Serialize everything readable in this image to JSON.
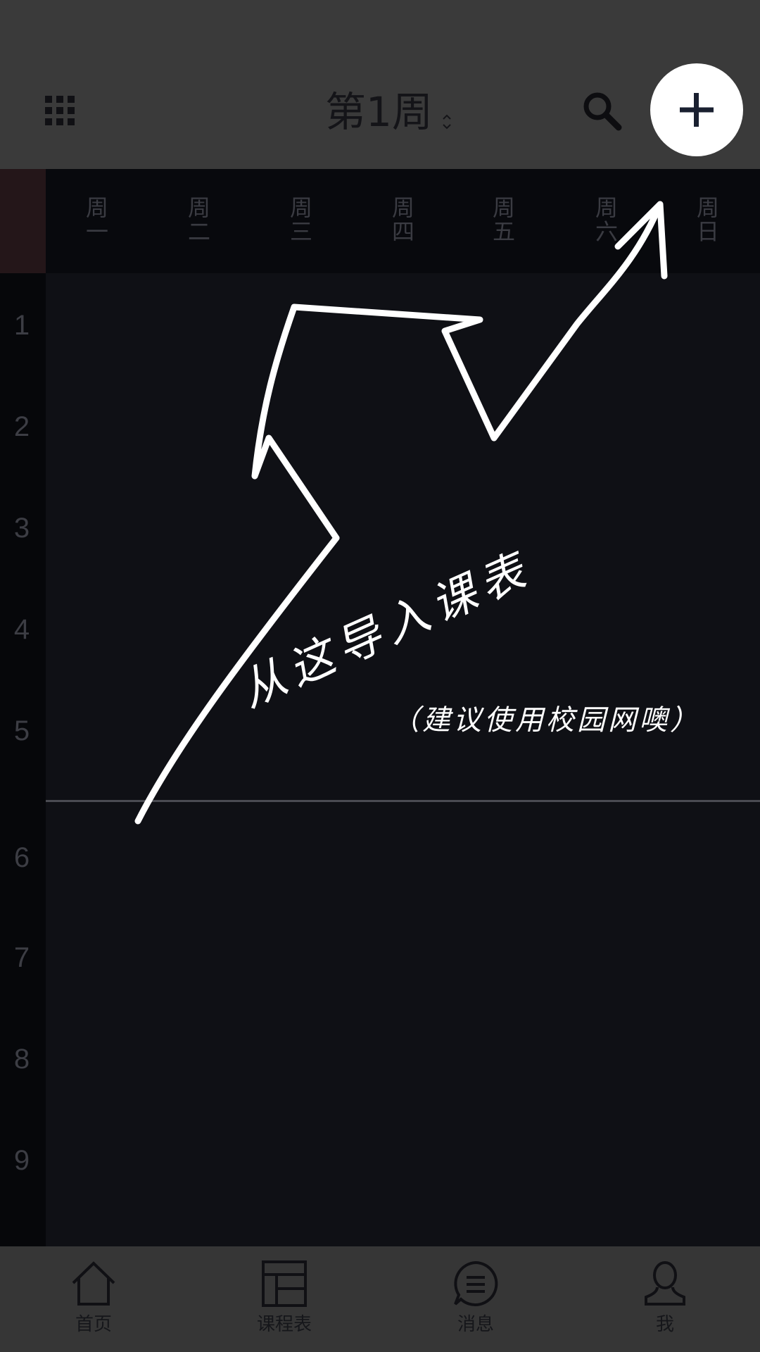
{
  "header": {
    "week_title": "第1周"
  },
  "week_header": {
    "days": [
      {
        "top": "周",
        "bottom": "一"
      },
      {
        "top": "周",
        "bottom": "二"
      },
      {
        "top": "周",
        "bottom": "三"
      },
      {
        "top": "周",
        "bottom": "四"
      },
      {
        "top": "周",
        "bottom": "五"
      },
      {
        "top": "周",
        "bottom": "六"
      },
      {
        "top": "周",
        "bottom": "日"
      }
    ]
  },
  "periods": [
    "1",
    "2",
    "3",
    "4",
    "5",
    "6",
    "7",
    "8",
    "9"
  ],
  "annotation": {
    "main_text": "从这导入课表",
    "sub_text": "（建议使用校园网噢）"
  },
  "bottom_nav": {
    "items": [
      {
        "label": "首页",
        "icon": "home-icon"
      },
      {
        "label": "课程表",
        "icon": "timetable-icon"
      },
      {
        "label": "消息",
        "icon": "message-icon"
      },
      {
        "label": "我",
        "icon": "profile-icon"
      }
    ]
  },
  "colors": {
    "topbar": "#3a3a3a",
    "grid_background": "#0f1015",
    "bottom_nav": "#363636",
    "annotation": "#ffffff"
  }
}
